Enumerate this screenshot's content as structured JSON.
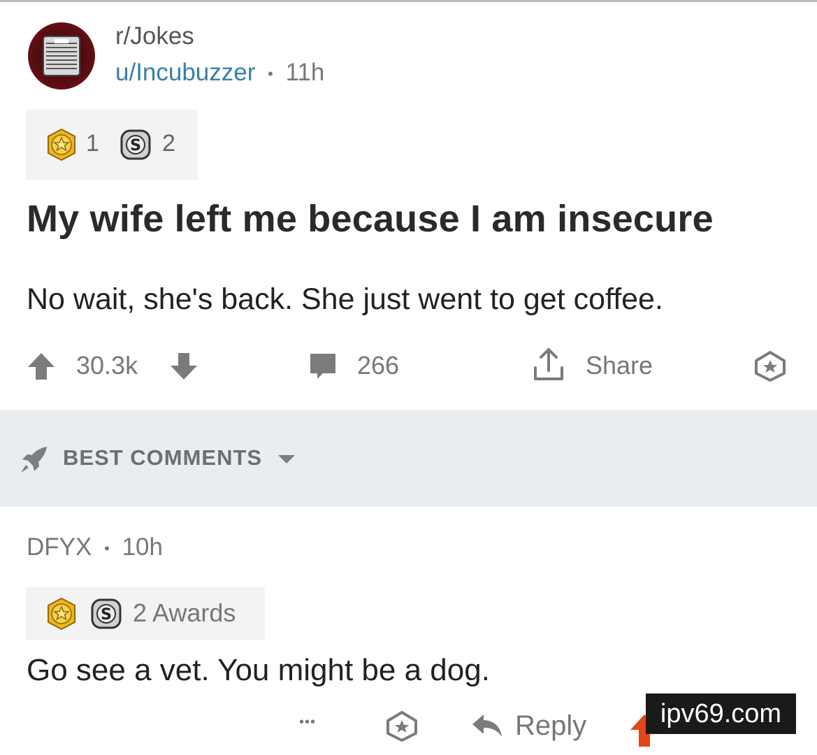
{
  "post": {
    "subreddit": "r/Jokes",
    "username": "u/Incubuzzer",
    "separator": "•",
    "time": "11h",
    "awards": {
      "gold_count": "1",
      "silver_count": "2"
    },
    "title": "My wife left me because I am insecure",
    "body": "No wait, she's back. She just went to get coffee.",
    "votes": "30.3k",
    "comments": "266",
    "share_label": "Share"
  },
  "sort": {
    "label": "BEST COMMENTS"
  },
  "comment": {
    "author": "DFYX",
    "separator": "•",
    "time": "10h",
    "awards_label": "2 Awards",
    "text": "Go see a vet. You might be a dog.",
    "more_label": "•••",
    "reply_label": "Reply"
  },
  "watermark": "ipv69.com",
  "icons": {
    "avatar": "subreddit-avatar",
    "gold": "gold-award-icon",
    "silver": "silver-award-icon",
    "upvote": "upvote-arrow-icon",
    "downvote": "downvote-arrow-icon",
    "comment": "comment-bubble-icon",
    "share": "share-icon",
    "save": "save-star-icon",
    "rocket": "rocket-icon",
    "reply": "reply-arrow-icon"
  },
  "colors": {
    "username": "#3a7fa6",
    "sortbar": "#eaedf0",
    "upvote_orange": "#e2471a"
  }
}
